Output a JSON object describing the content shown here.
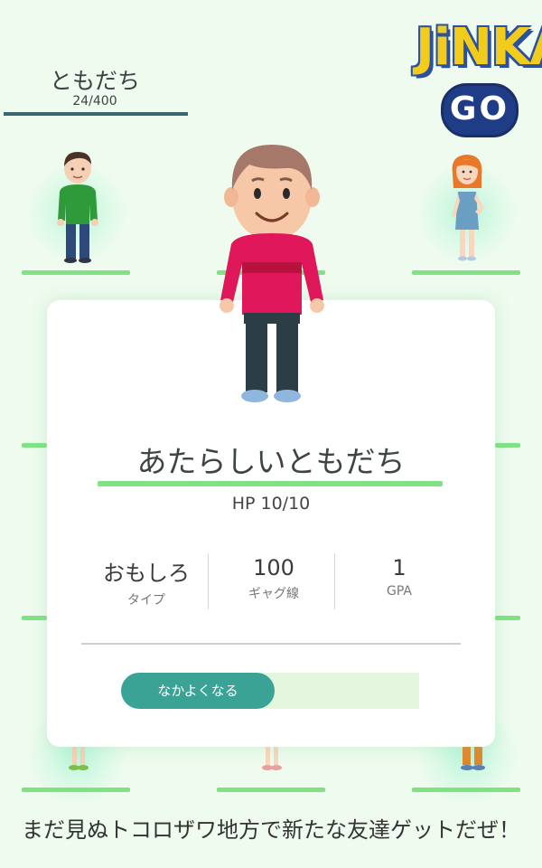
{
  "header": {
    "title": "ともだち",
    "count": "24/400"
  },
  "logo": {
    "word": "JiNKA",
    "sub": "GO"
  },
  "friend_card": {
    "name": "あたらしいともだち",
    "hp": "HP 10/10",
    "stats": [
      {
        "value": "おもしろ",
        "label": "タイプ"
      },
      {
        "value": "100",
        "label": "ギャグ線"
      },
      {
        "value": "1",
        "label": "GPA"
      }
    ],
    "action_label": "なかよくなる",
    "progress_fraction": 0.0
  },
  "tagline": "まだ見ぬトコロザワ地方で新たな友達ゲットだぜ！",
  "colors": {
    "background": "#eefbee",
    "accent_green": "#7fe384",
    "button_teal": "#3aa396",
    "header_bar": "#3a6670"
  }
}
